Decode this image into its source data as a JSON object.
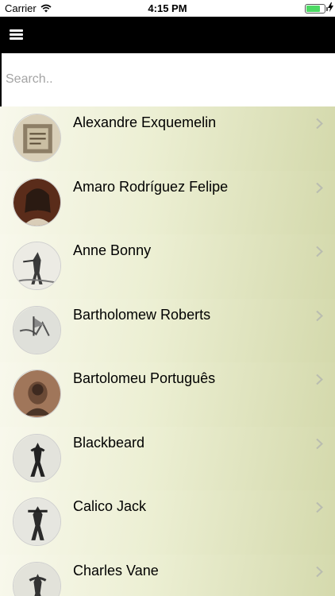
{
  "status_bar": {
    "carrier": "Carrier",
    "time": "4:15 PM",
    "wifi_icon": "wifi-icon",
    "battery_icon": "battery-icon",
    "charging_icon": "lightning-icon",
    "battery_level": 0.75
  },
  "nav": {
    "menu_icon": "hamburger-menu-icon",
    "background": "#000000"
  },
  "search": {
    "placeholder": "Search..",
    "value": ""
  },
  "list": {
    "items": [
      {
        "name": "Alexandre Exquemelin",
        "icon": "portrait-engraving"
      },
      {
        "name": "Amaro Rodríguez Felipe",
        "icon": "portrait-painting"
      },
      {
        "name": "Anne Bonny",
        "icon": "portrait-engraving"
      },
      {
        "name": "Bartholomew Roberts",
        "icon": "portrait-engraving"
      },
      {
        "name": "Bartolomeu Português",
        "icon": "portrait-engraving"
      },
      {
        "name": "Blackbeard",
        "icon": "portrait-engraving"
      },
      {
        "name": "Calico Jack",
        "icon": "portrait-engraving"
      },
      {
        "name": "Charles Vane",
        "icon": "portrait-engraving"
      }
    ],
    "chevron_icon": "chevron-right-icon"
  }
}
